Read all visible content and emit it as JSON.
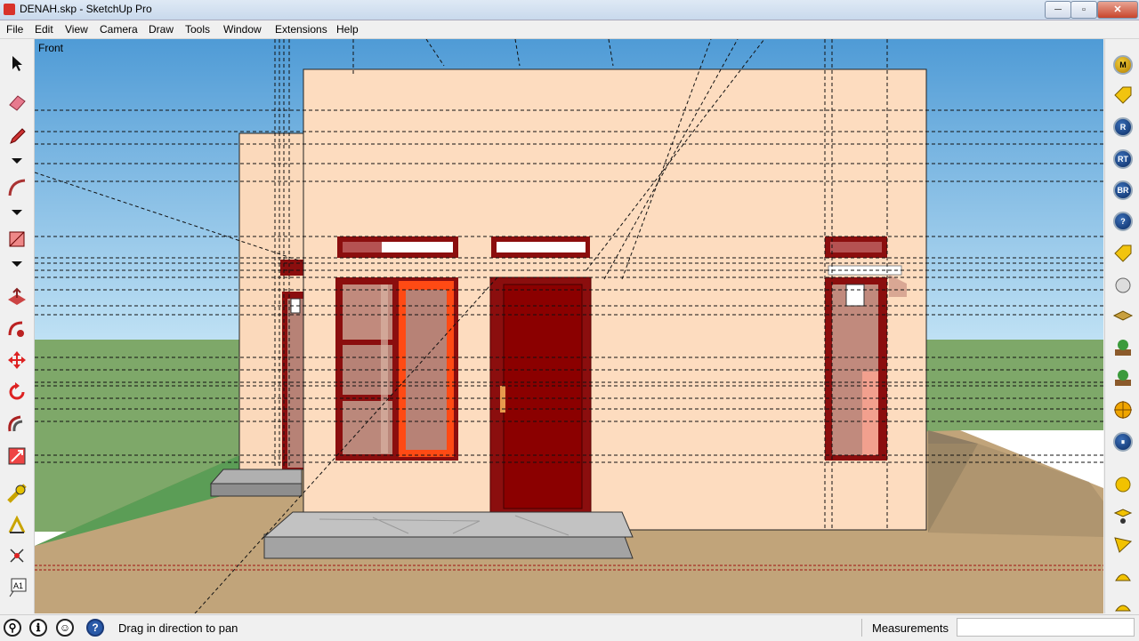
{
  "window": {
    "title": "DENAH.skp - SketchUp Pro",
    "minimize": "─",
    "maximize": "▫",
    "close": "✕"
  },
  "menu": [
    "File",
    "Edit",
    "View",
    "Camera",
    "Draw",
    "Tools",
    "Window",
    "Extensions",
    "Help"
  ],
  "viewport": {
    "scene_label": "Front"
  },
  "left_toolbar": [
    "select-icon",
    "eraser-icon",
    "pencil-icon",
    "dropdown-icon",
    "arc-icon",
    "dropdown-icon",
    "rectangle-icon",
    "dropdown-icon",
    "push-pull-icon",
    "follow-me-icon",
    "move-icon",
    "rotate-icon",
    "offset-icon",
    "scale-icon",
    "tape-measure-icon",
    "protractor-icon",
    "axes-icon",
    "text-label-icon"
  ],
  "right_toolbar": {
    "badges": [
      "M",
      "",
      "R",
      "RT",
      "BR",
      "?"
    ],
    "tools": [
      "tag-icon",
      "sphere-icon",
      "layers-icon",
      "plant-icon",
      "plant-icon",
      "target-icon",
      "pause-icon",
      "yellow-circle-icon",
      "section-plane-icon",
      "triangle-icon",
      "dome-icon",
      "dome-icon"
    ]
  },
  "status": {
    "hint": "Drag in direction to pan",
    "measurements_label": "Measurements",
    "measurements_value": "",
    "help": "?"
  },
  "colors": {
    "sky": "#5ba4d8",
    "grass": "#7fa86a",
    "ground": "#c1a47a",
    "wall": "#fddcbf",
    "frame": "#8b0e0e",
    "door": "#8b0000",
    "accent_frame": "#ff4a14"
  }
}
